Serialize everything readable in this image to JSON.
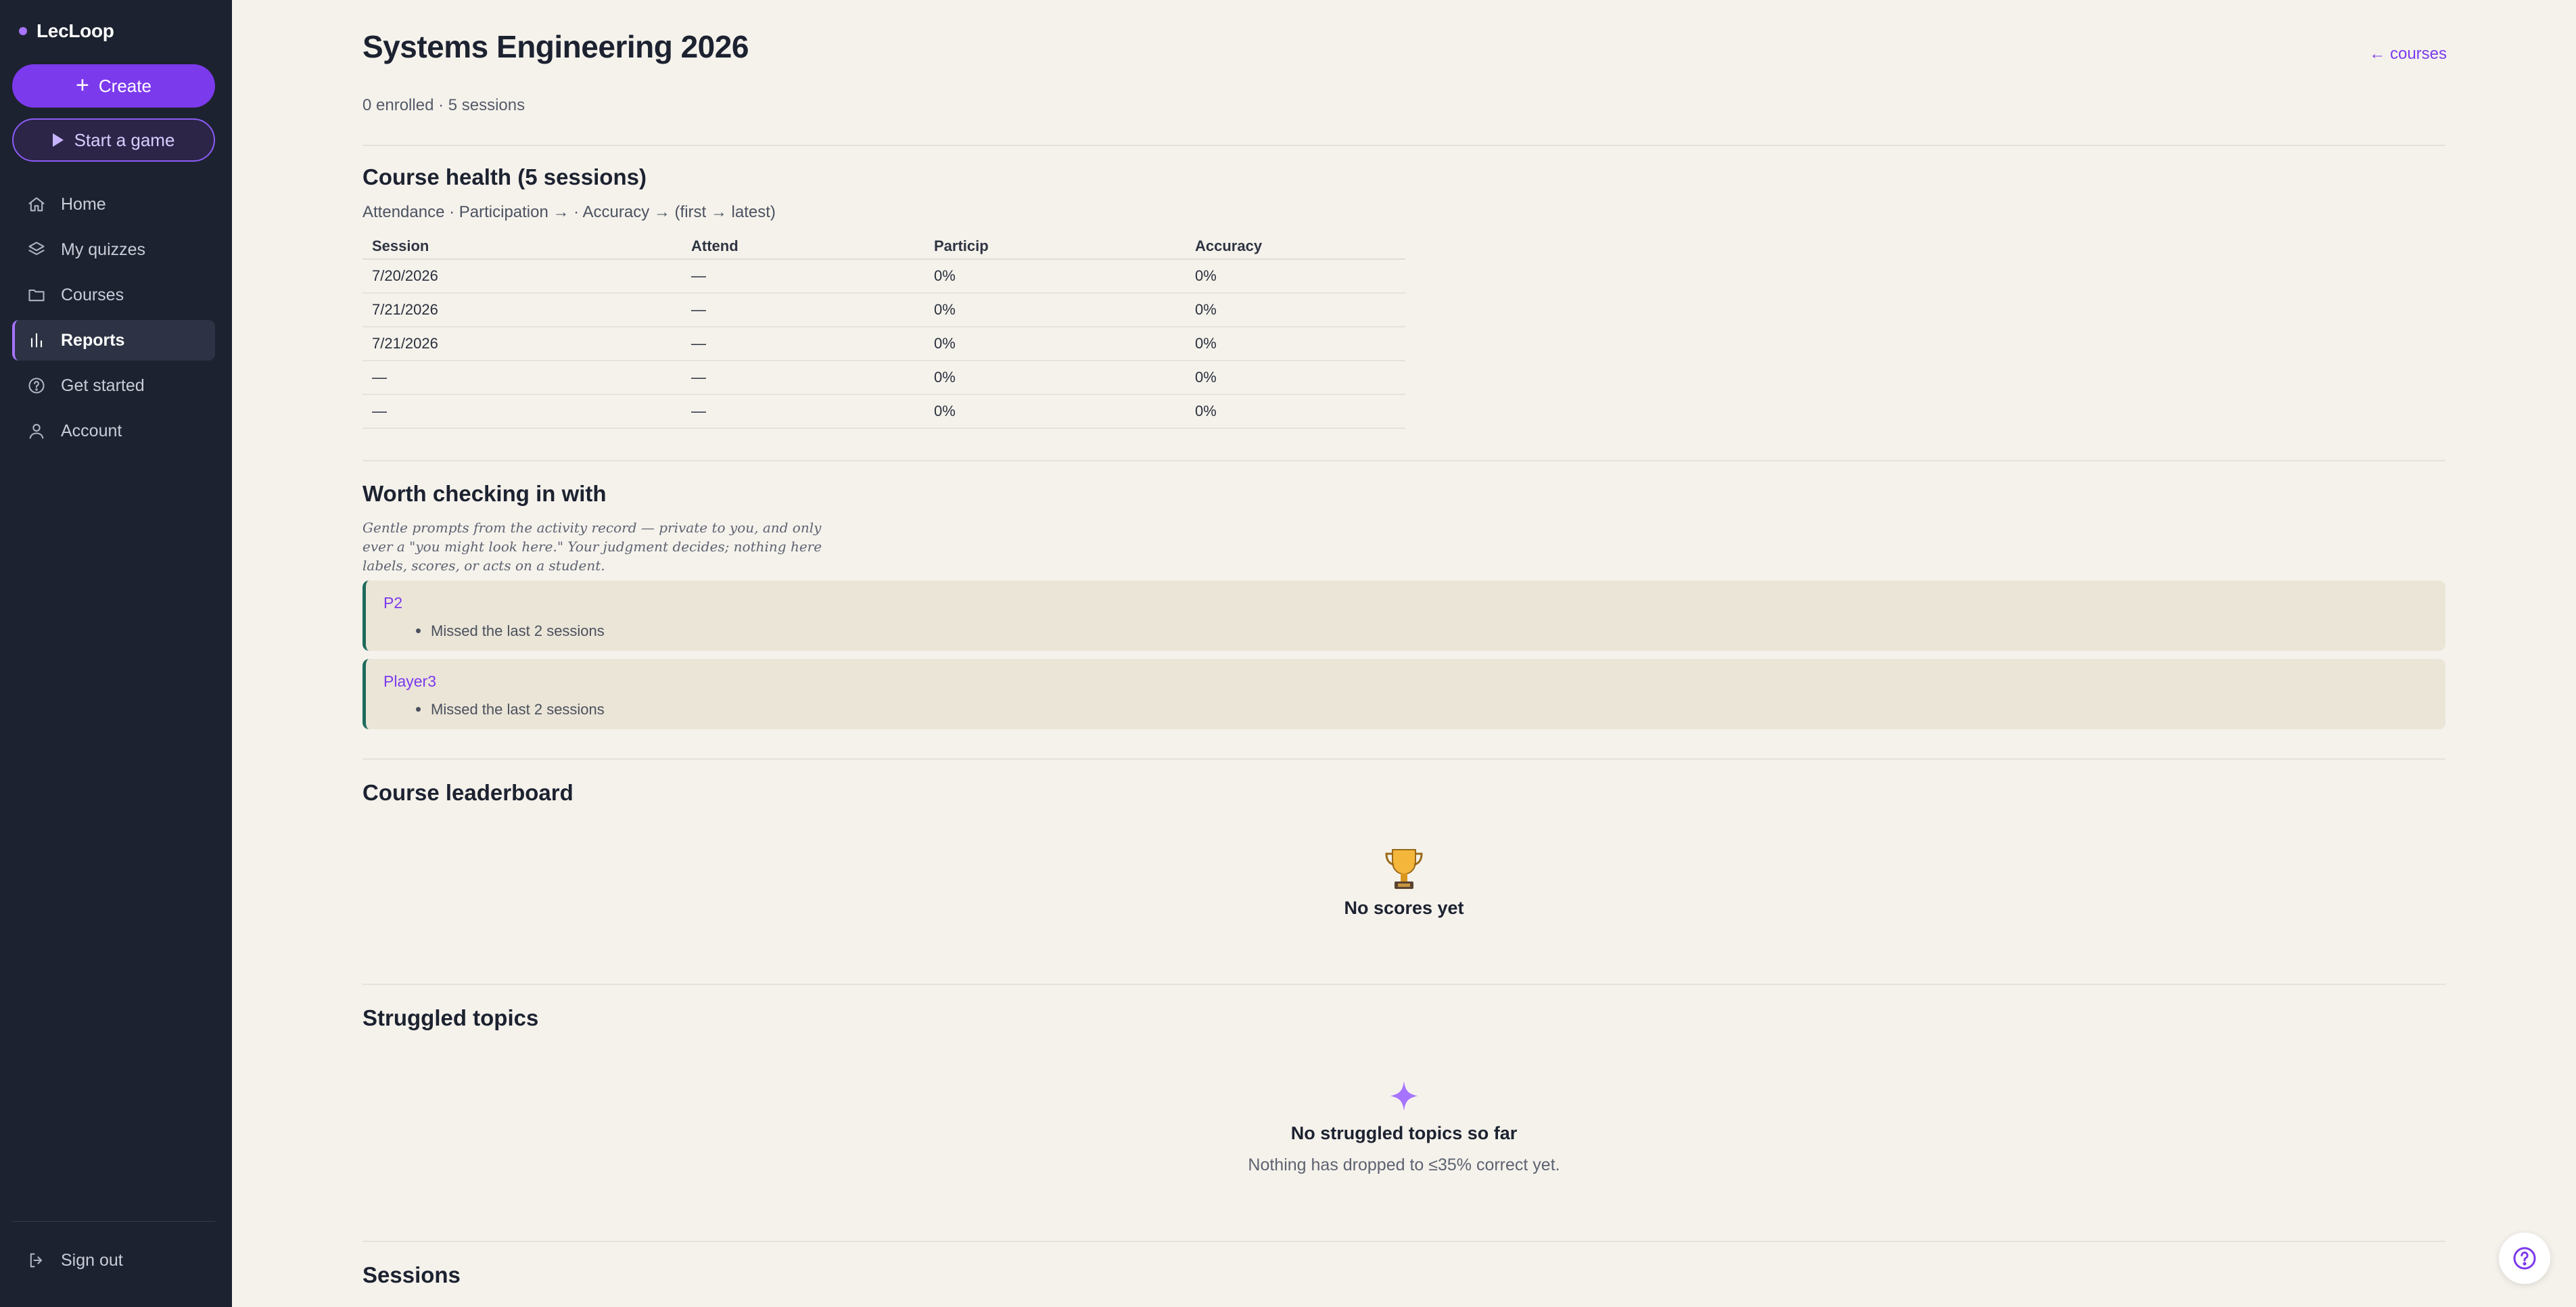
{
  "brand": {
    "name": "LecLoop"
  },
  "sidebar": {
    "create_label": "Create",
    "game_label": "Start a game",
    "items": [
      {
        "label": "Home",
        "icon": "home-icon"
      },
      {
        "label": "My quizzes",
        "icon": "layers-icon"
      },
      {
        "label": "Courses",
        "icon": "folder-icon"
      },
      {
        "label": "Reports",
        "icon": "bar-chart-icon",
        "active": true
      },
      {
        "label": "Get started",
        "icon": "help-circle-icon"
      },
      {
        "label": "Account",
        "icon": "user-icon"
      }
    ],
    "signout_label": "Sign out"
  },
  "header": {
    "title": "Systems Engineering 2026",
    "back_link": "← courses",
    "subline": "0 enrolled · 5 sessions"
  },
  "course_health": {
    "title": "Course health (5 sessions)",
    "subtitle": "Attendance · Participation → · Accuracy → (first → latest)",
    "columns": [
      "Session",
      "Attend",
      "Particip",
      "Accuracy"
    ],
    "rows": [
      [
        "7/20/2026",
        "—",
        "0%",
        "0%"
      ],
      [
        "7/21/2026",
        "—",
        "0%",
        "0%"
      ],
      [
        "7/21/2026",
        "—",
        "0%",
        "0%"
      ],
      [
        "—",
        "—",
        "0%",
        "0%"
      ],
      [
        "—",
        "—",
        "0%",
        "0%"
      ]
    ]
  },
  "checkin": {
    "title": "Worth checking in with",
    "note": "Gentle prompts from the activity record — private to you, and only ever a \"you might look here.\" Your judgment decides; nothing here labels, scores, or acts on a student.",
    "students": [
      {
        "name": "P2",
        "reason": "Missed the last 2 sessions"
      },
      {
        "name": "Player3",
        "reason": "Missed the last 2 sessions"
      }
    ]
  },
  "leaderboard": {
    "title": "Course leaderboard",
    "empty_icon": "trophy-icon",
    "empty_title": "No scores yet"
  },
  "struggled": {
    "title": "Struggled topics",
    "empty_icon": "sparkle-icon",
    "empty_title": "No struggled topics so far",
    "empty_sub": "Nothing has dropped to ≤35% correct yet."
  },
  "sessions": {
    "title": "Sessions"
  },
  "colors": {
    "accent": "#7c3aed",
    "sidebar_bg": "#1d2230",
    "page_bg": "#f5f2ec",
    "card_border": "#1f6b5c"
  }
}
